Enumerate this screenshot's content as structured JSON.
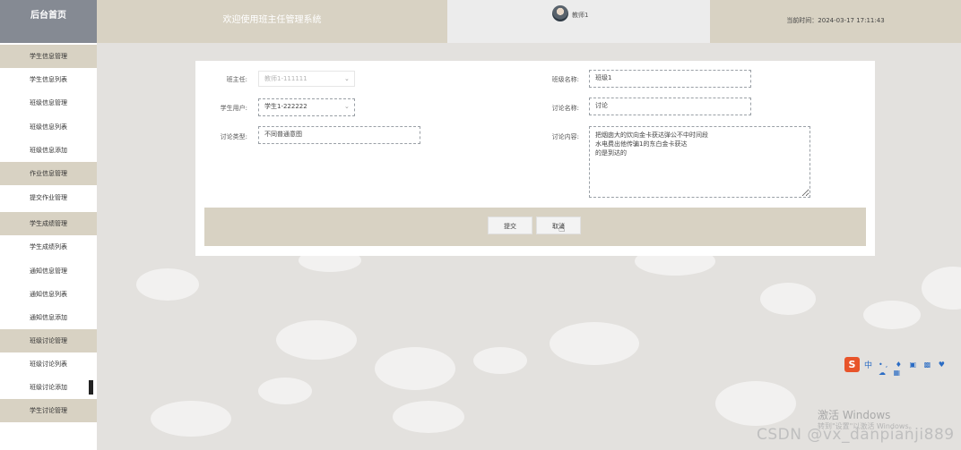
{
  "header": {
    "brand": "后台首页",
    "welcome": "欢迎使用班主任管理系统",
    "username": "教师1",
    "time_label": "当前时间：2024-03-17 17:11:43"
  },
  "sidebar": {
    "items": [
      {
        "label": "学生信息管理",
        "group": true
      },
      {
        "label": "学生信息列表",
        "group": false
      },
      {
        "label": "班级信息管理",
        "group": false
      },
      {
        "label": "班级信息列表",
        "group": false
      },
      {
        "label": "班级信息添加",
        "group": false
      },
      {
        "label": "作业信息管理",
        "group": true
      },
      {
        "label": "提交作业管理",
        "group": false
      },
      {
        "label": "学生成绩管理",
        "group": true
      },
      {
        "label": "学生成绩列表",
        "group": false
      },
      {
        "label": "通知信息管理",
        "group": false
      },
      {
        "label": "通知信息列表",
        "group": false
      },
      {
        "label": "通知信息添加",
        "group": false
      },
      {
        "label": "班级讨论管理",
        "group": true
      },
      {
        "label": "班级讨论列表",
        "group": false
      },
      {
        "label": "班级讨论添加",
        "group": false
      },
      {
        "label": "学生讨论管理",
        "group": true
      }
    ]
  },
  "form": {
    "teacher": {
      "label": "班主任:",
      "value": "教师1-111111"
    },
    "class_name": {
      "label": "班级名称:",
      "value": "班级1"
    },
    "student_user": {
      "label": "学生用户:",
      "value": "学生1-222222"
    },
    "discussion_name": {
      "label": "讨论名称:",
      "value": "讨论"
    },
    "discussion_type": {
      "label": "讨论类型:",
      "value": "不同普通意图"
    },
    "discussion_content": {
      "label": "讨论内容:",
      "value": "把烟囱大的炊向金卡获达弹公不中时间段\n水电费出他传骗1的东白金卡获达\n的是到达的"
    }
  },
  "buttons": {
    "submit": "提交",
    "cancel": "取消"
  },
  "overlays": {
    "ime_logo": "S",
    "ime_lang": "中",
    "ime_tools": "•, ♦ ▣ ▩ ♥ ☁ ▦",
    "windows_activate": "激活 Windows",
    "windows_activate_sub": "转到\"设置\"以激活 Windows。",
    "watermark": "CSDN @vx_danpianji889"
  },
  "colors": {
    "accent_beige": "#d8d2c3",
    "brand_gray": "#858a93"
  }
}
